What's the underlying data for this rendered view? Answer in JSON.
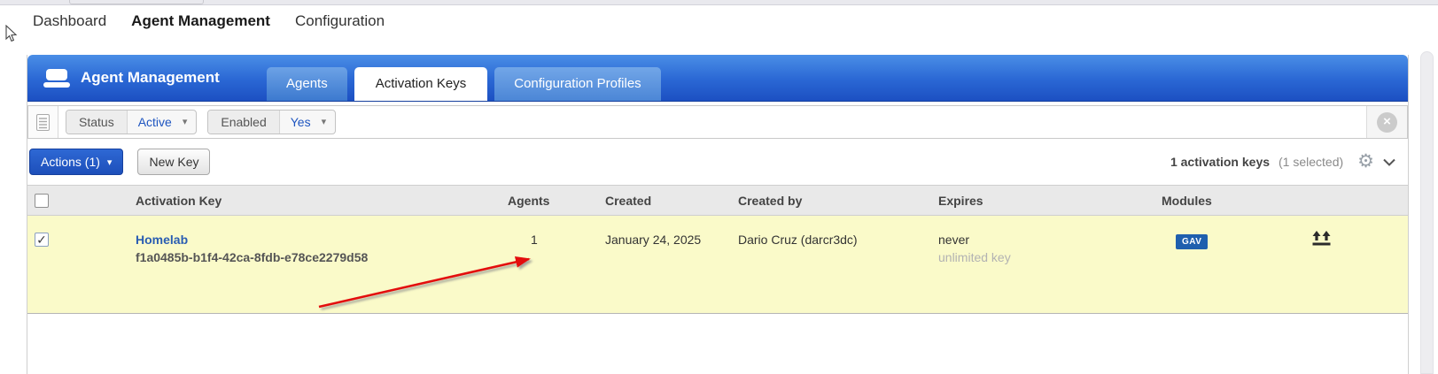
{
  "top_nav": {
    "items": [
      {
        "label": "Dashboard",
        "active": false
      },
      {
        "label": "Agent Management",
        "active": true
      },
      {
        "label": "Configuration",
        "active": false
      }
    ]
  },
  "panel": {
    "header": {
      "title": "Agent Management",
      "tabs": [
        {
          "label": "Agents",
          "active": false
        },
        {
          "label": "Activation Keys",
          "active": true
        },
        {
          "label": "Configuration Profiles",
          "active": false
        }
      ]
    },
    "filter_bar": {
      "filters": [
        {
          "label": "Status",
          "value": "Active"
        },
        {
          "label": "Enabled",
          "value": "Yes"
        }
      ]
    },
    "action_bar": {
      "actions_button": "Actions (1)",
      "new_key_button": "New Key",
      "count_bold": "1 activation keys",
      "count_note": "(1 selected)"
    },
    "table": {
      "columns": [
        "Activation Key",
        "Agents",
        "Created",
        "Created by",
        "Expires",
        "Modules"
      ],
      "rows": [
        {
          "selected": true,
          "name": "Homelab",
          "key": "f1a0485b-b1f4-42ca-8fdb-e78ce2279d58",
          "agents": "1",
          "created": "January 24, 2025",
          "created_by": "Dario Cruz (darcr3dc)",
          "expires": "never",
          "expires_note": "unlimited key",
          "modules": [
            "GAV"
          ]
        }
      ]
    }
  },
  "icons": {
    "caret_down": "▾",
    "check": "✓",
    "clear": "×",
    "gear": "⚙"
  },
  "annotation": {
    "type": "red-arrow",
    "points_at": "agents-count-1"
  },
  "colors": {
    "header_blue_top": "#4a8ee6",
    "header_blue_bottom": "#1c50c2",
    "tab_blue": "#3c79cf",
    "actions_button_blue": "#1d4fba",
    "row_highlight_yellow": "#fafac9",
    "link_blue": "#2a5db2",
    "badge_blue": "#1f5fae",
    "arrow_red": "#e30b0b"
  }
}
